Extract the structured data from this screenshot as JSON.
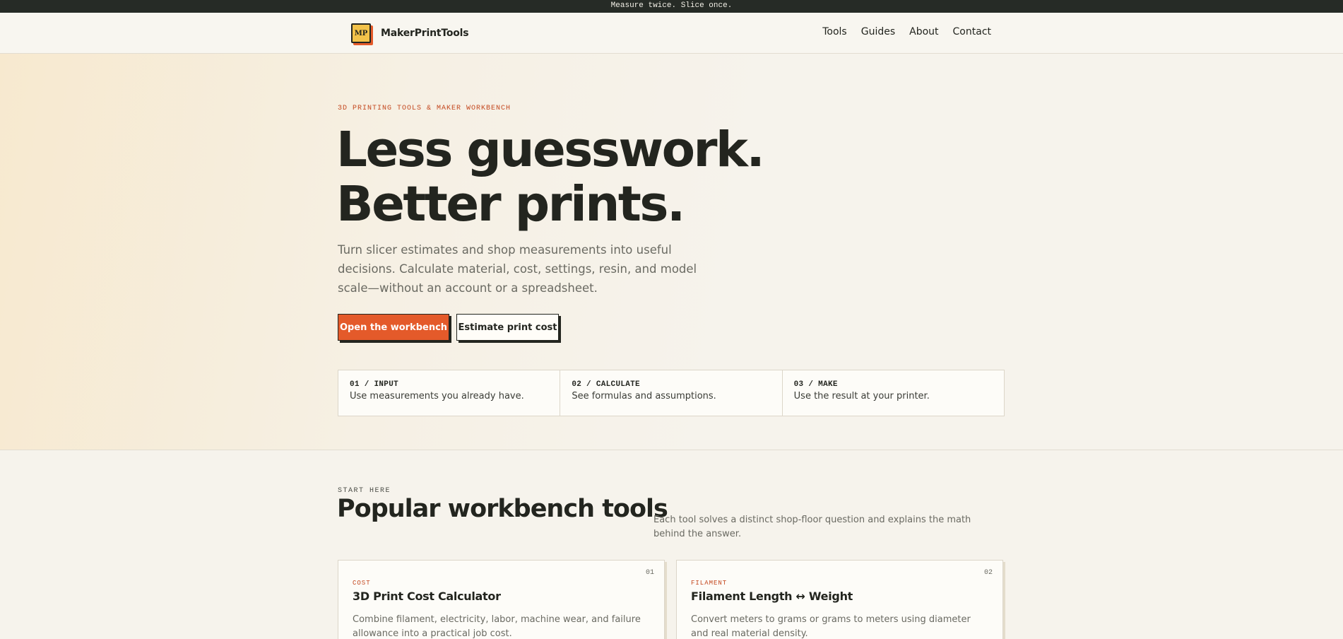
{
  "topbar": {
    "text": "Measure twice. Slice once."
  },
  "header": {
    "logo_mark": "MP",
    "brand_name": "MakerPrintTools",
    "nav": [
      "Tools",
      "Guides",
      "About",
      "Contact"
    ]
  },
  "hero": {
    "eyebrow": "3D PRINTING TOOLS & MAKER WORKBENCH",
    "headline_line1": "Less guesswork.",
    "headline_line2": "Better prints.",
    "lede": "Turn slicer estimates and shop measurements into useful decisions. Calculate material, cost, settings, resin, and model scale—without an account or a spreadsheet.",
    "primary_cta": "Open the workbench",
    "secondary_cta": "Estimate print cost",
    "steps": [
      {
        "num": "01 / INPUT",
        "text": "Use measurements you already have."
      },
      {
        "num": "02 / CALCULATE",
        "text": "See formulas and assumptions."
      },
      {
        "num": "03 / MAKE",
        "text": "Use the result at your printer."
      }
    ]
  },
  "tools_section": {
    "eyebrow": "START HERE",
    "title": "Popular workbench tools",
    "description": "Each tool solves a distinct shop-floor question and explains the math behind the answer.",
    "cards": [
      {
        "index": "01",
        "tag": "COST",
        "title": "3D Print Cost Calculator",
        "description": "Combine filament, electricity, labor, machine wear, and failure allowance into a practical job cost."
      },
      {
        "index": "02",
        "tag": "FILAMENT",
        "title": "Filament Length ↔ Weight",
        "description": "Convert meters to grams or grams to meters using diameter and real material density."
      }
    ]
  },
  "colors": {
    "accent": "#e45a2a",
    "logo_yellow": "#f2c24a",
    "ink": "#23251f",
    "topbar_bg": "#262b26"
  }
}
